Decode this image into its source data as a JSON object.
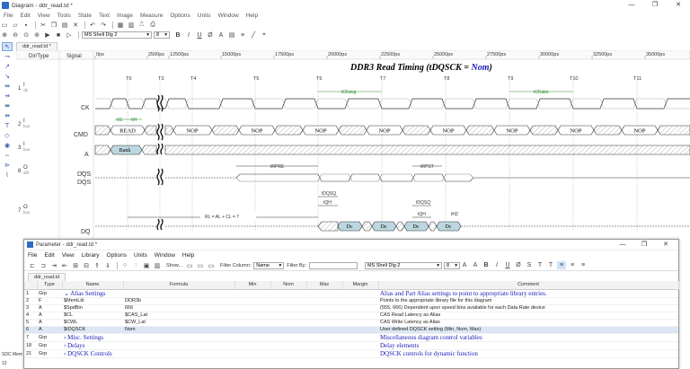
{
  "window": {
    "title": "Diagram - ddr_read.td *",
    "menu": [
      "File",
      "Edit",
      "View",
      "Tools",
      "State",
      "Text",
      "Image",
      "Measure",
      "Options",
      "Units",
      "Window",
      "Help"
    ],
    "controls": [
      "—",
      "❐",
      "✕"
    ]
  },
  "toolbar": {
    "font_name": "MS Shell Dlg 2",
    "font_size": "8",
    "bold": "B",
    "italic": "I",
    "underline": "U"
  },
  "doc_tab": "ddr_read.td *",
  "diagram": {
    "title_prefix": "DDR3 Read Timing (tDQSCK = ",
    "title_value": "Nom",
    "title_suffix": ")",
    "header_dir": "Dir/Type",
    "header_signal": "Signal",
    "ruler": [
      "0ps",
      "2500ps",
      "12500ps",
      "15000ps",
      "17500ps",
      "20000ps",
      "22500ps",
      "25000ps",
      "27500ps",
      "30000ps",
      "32500ps",
      "35000ps"
    ],
    "time_markers": [
      "T0",
      "T3",
      "T4",
      "T5",
      "T6",
      "T7",
      "T8",
      "T9",
      "T10",
      "T11"
    ],
    "signals": [
      {
        "row": "1",
        "dir": "I",
        "type": "clk",
        "name": "CK"
      },
      {
        "row": "2",
        "dir": "I",
        "type": "bus",
        "name": "CMD"
      },
      {
        "row": "3",
        "dir": "I",
        "type": "bus",
        "name": "A"
      },
      {
        "row": "6",
        "dir": "O",
        "type": "diff",
        "name": "DQS",
        "name2": "DQS"
      },
      {
        "row": "7",
        "dir": "O",
        "type": "bus",
        "name": "DQ"
      }
    ],
    "cmd_values": [
      "READ",
      "NOP",
      "NOP",
      "NOP",
      "NOP",
      "NOP",
      "NOP",
      "NOP",
      "NOP",
      "NOP"
    ],
    "addr_value": "Bank",
    "dq_values": [
      "Dc",
      "Dc",
      "Dc",
      "Dc"
    ],
    "labels": {
      "tckavg": "tCKavg",
      "tckabs": "tCKabs",
      "tis": "tIS",
      "tih": "tIH",
      "trpre": "tRPRE",
      "trpst": "tRPST",
      "tdqsq1": "tDQSQ",
      "tqh1": "tQH",
      "tdqsq2": "tDQSQ",
      "tqh2": "tQH",
      "thz": "tHZ",
      "rl": "RL = AL + CL = 7"
    }
  },
  "param_window": {
    "title": "Parameter - ddr_read.td *",
    "menu": [
      "File",
      "Edit",
      "View",
      "Library",
      "Options",
      "Units",
      "Window",
      "Help"
    ],
    "show_label": "Show...",
    "filter_column_label": "Filter Column:",
    "filter_column_value": "Name",
    "filter_by_label": "Filter By:",
    "font_name": "MS Shell Dlg 2",
    "font_size": "8",
    "tab": "ddr_read.td",
    "columns": [
      "",
      "Type",
      "Name",
      "Formula",
      "Min",
      "Nom",
      "Max",
      "Margin",
      "Comment"
    ],
    "rows": [
      {
        "no": "1",
        "type": "Grp",
        "expander": "⌄",
        "name": "Alias Settings",
        "formula": "",
        "comment": "Alias and Part Alias settings to point to appropriate library entries.",
        "group": true
      },
      {
        "no": "2",
        "type": "F",
        "expander": "",
        "name": "$MemLib",
        "formula": "DDR3b",
        "comment": "Points to the appropriate library file for this diagram",
        "group": false
      },
      {
        "no": "3",
        "type": "A",
        "expander": "",
        "name": "$SpdBin",
        "formula": "666",
        "comment": "(555, 666) Dependent upon speed bins available for each Data Rate device",
        "group": false
      },
      {
        "no": "4",
        "type": "A",
        "expander": "",
        "name": "$CL",
        "formula": "$CAS_Lat",
        "comment": "CAS Read Latency as Alias",
        "group": false
      },
      {
        "no": "5",
        "type": "A",
        "expander": "",
        "name": "$CWL",
        "formula": "$CW_Lat",
        "comment": "CAS Write Latency as Alias",
        "group": false
      },
      {
        "no": "6",
        "type": "A",
        "expander": "",
        "name": "$tDQSCK",
        "formula": "Nom",
        "comment": "User defined DQSCK setting (Min, Nom, Max)",
        "group": false,
        "selected": true
      },
      {
        "no": "7",
        "type": "Grp",
        "expander": "›",
        "name": "Misc. Settings",
        "formula": "",
        "comment": "Miscellaneous diagram control variables",
        "group": true
      },
      {
        "no": "18",
        "type": "Grp",
        "expander": "›",
        "name": "Delays",
        "formula": "",
        "comment": "Delay elements",
        "group": true
      },
      {
        "no": "21",
        "type": "Grp",
        "expander": "›",
        "name": "DQSCK Controls",
        "formula": "",
        "comment": "DQSCK controls for dynamic function",
        "group": true
      }
    ]
  },
  "status": "SDC Mem 12"
}
